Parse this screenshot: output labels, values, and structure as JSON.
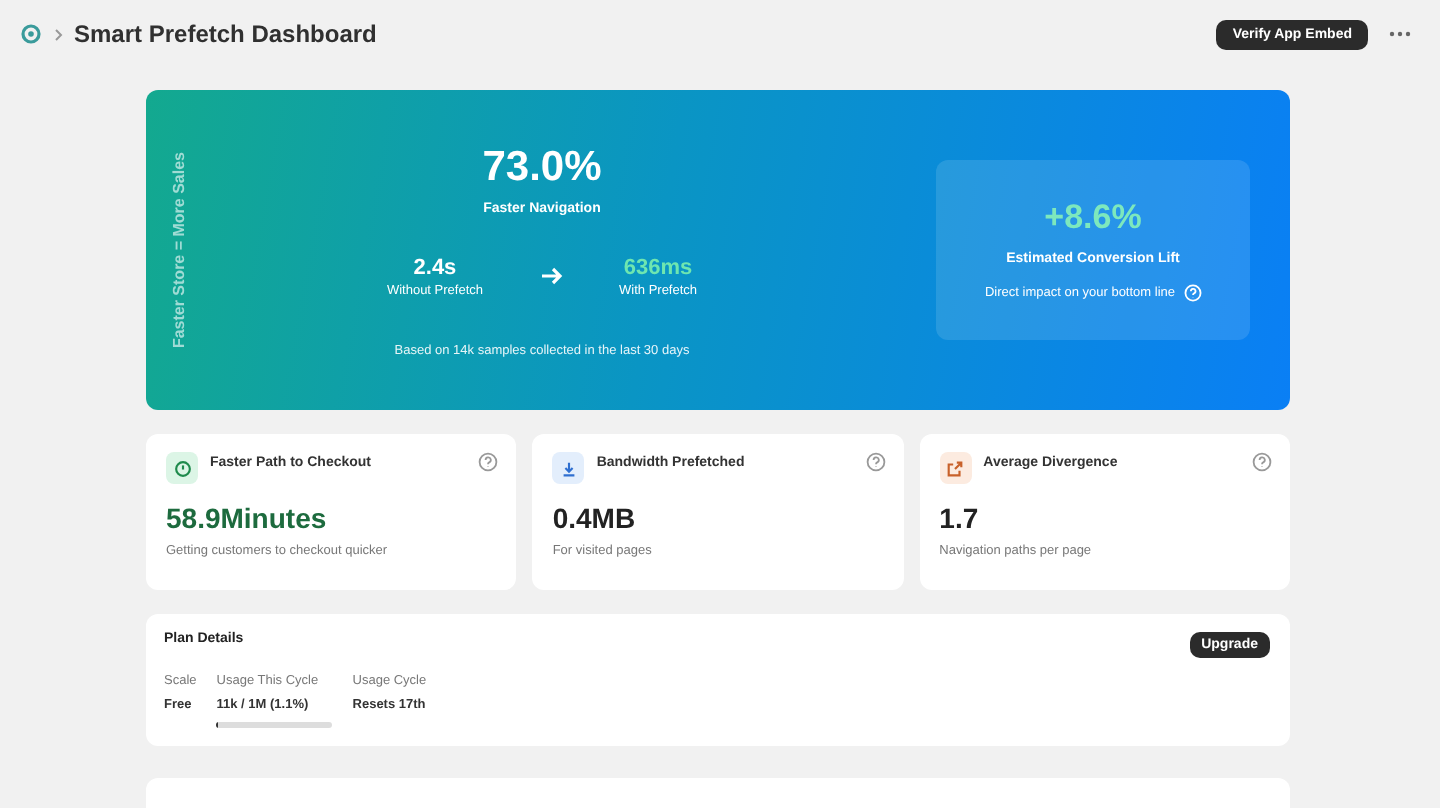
{
  "header": {
    "title": "Smart Prefetch Dashboard",
    "action": "Verify App Embed"
  },
  "hero": {
    "side_label": "Faster Store = More Sales",
    "headline": "73.0%",
    "headline_label": "Faster Navigation",
    "before": {
      "value": "2.4s",
      "label": "Without Prefetch"
    },
    "after": {
      "value": "636ms",
      "label": "With Prefetch"
    },
    "footnote": "Based on 14k samples collected in the last 30 days",
    "lift": {
      "value": "+8.6%",
      "label": "Estimated Conversion Lift",
      "note": "Direct impact on your bottom line"
    }
  },
  "metrics": [
    {
      "kind": "clock",
      "title": "Faster Path to Checkout",
      "value": "58.9Minutes",
      "caption": "Getting customers to checkout quicker"
    },
    {
      "kind": "download",
      "title": "Bandwidth Prefetched",
      "value": "0.4MB",
      "caption": "For visited pages"
    },
    {
      "kind": "external",
      "title": "Average Divergence",
      "value": "1.7",
      "caption": "Navigation paths per page"
    }
  ],
  "plan": {
    "title": "Plan Details",
    "action": "Upgrade",
    "fields": [
      {
        "label": "Scale",
        "value": "Free"
      },
      {
        "label": "Usage This Cycle",
        "value": "11k / 1M (1.1%)",
        "level": 0.011
      },
      {
        "label": "Usage Cycle",
        "value": "Resets 17th"
      }
    ]
  }
}
